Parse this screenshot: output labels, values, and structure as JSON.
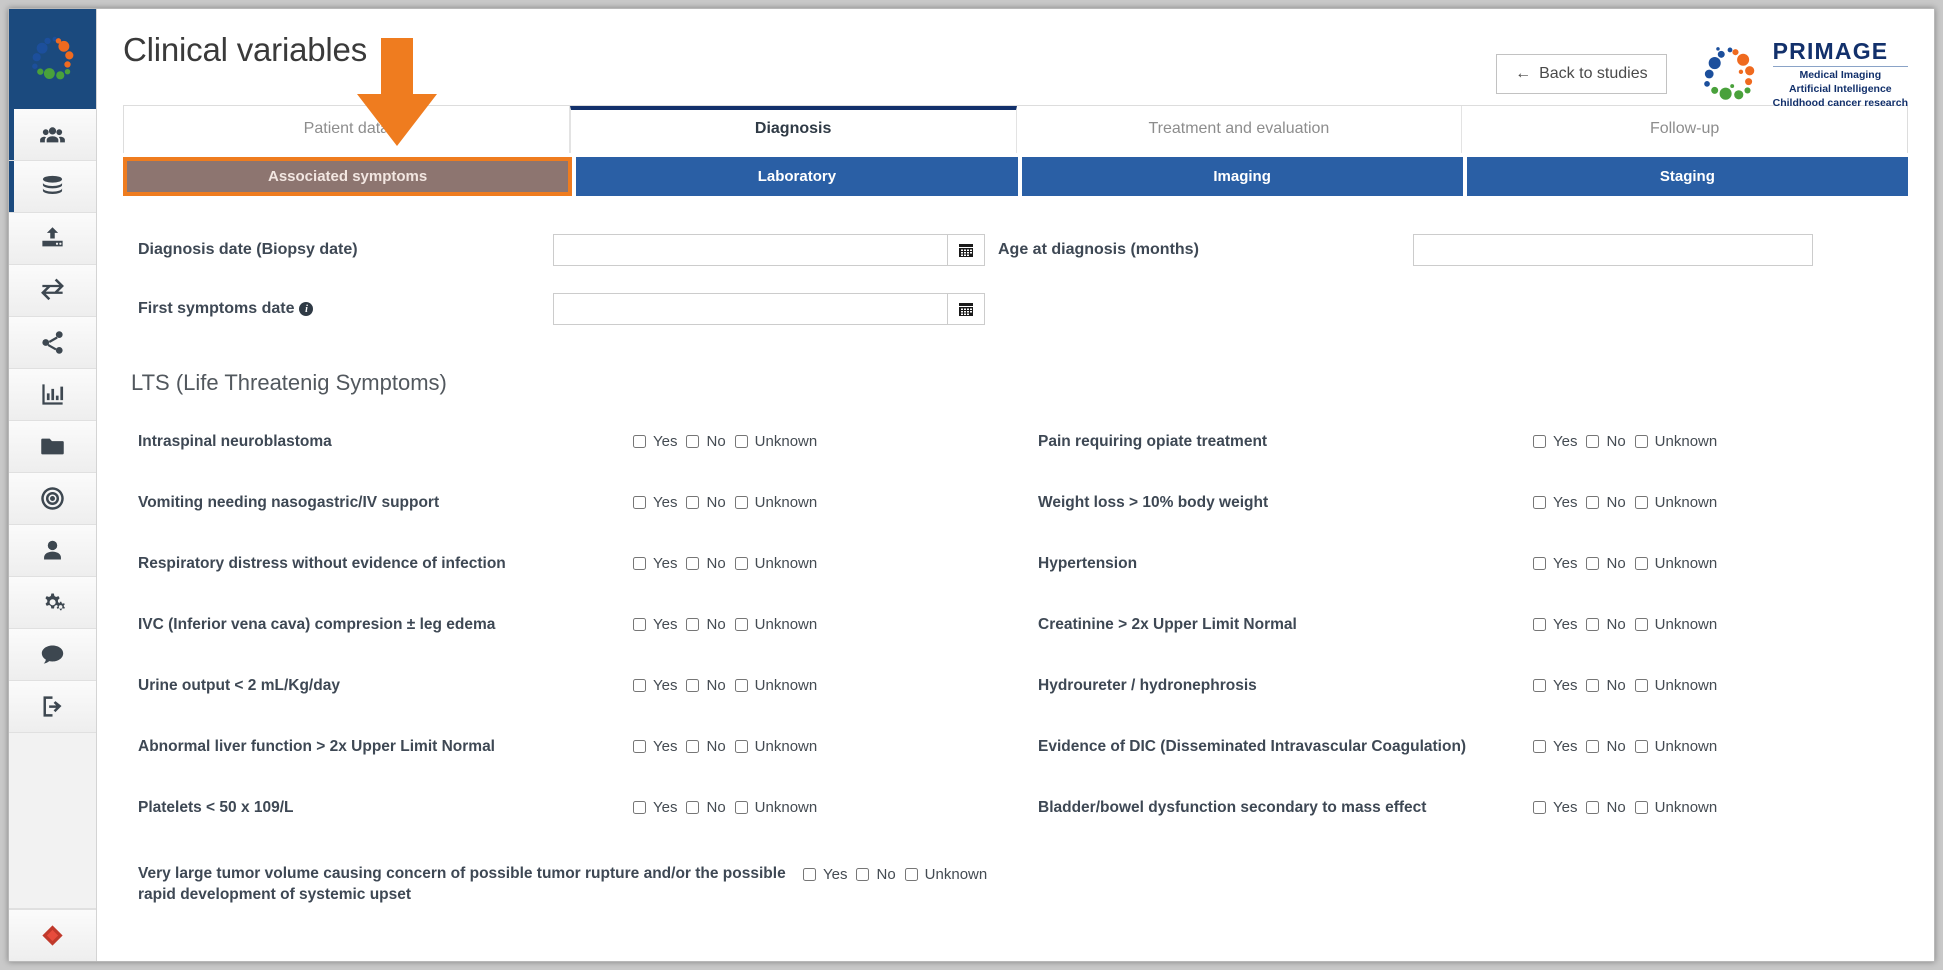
{
  "app": {
    "page_title": "Clinical variables",
    "back_button": "Back to studies",
    "back_arrow_icon": "arrow-left-icon",
    "brand": {
      "name": "PRIMAGE",
      "tagline_line1": "Medical Imaging",
      "tagline_line2": "Artificial Intelligence",
      "tagline_line3": "Childhood cancer research"
    },
    "accent_orange": "#ef7c1f",
    "accent_blue": "#2a5fa5",
    "brand_navy": "#12306b"
  },
  "sidebar": {
    "logo_icon": "primage-sphere-logo-icon",
    "items": [
      {
        "icon": "users-group-icon",
        "name": "patients",
        "active": true
      },
      {
        "icon": "database-icon",
        "name": "database",
        "active": true
      },
      {
        "icon": "upload-server-icon",
        "name": "upload",
        "active": false
      },
      {
        "icon": "exchange-arrows-icon",
        "name": "transfer",
        "active": false
      },
      {
        "icon": "share-nodes-icon",
        "name": "share",
        "active": false
      },
      {
        "icon": "bar-chart-icon",
        "name": "statistics",
        "active": false
      },
      {
        "icon": "folder-icon",
        "name": "files",
        "active": false
      },
      {
        "icon": "bullseye-target-icon",
        "name": "targets",
        "active": false
      },
      {
        "icon": "user-icon",
        "name": "profile",
        "active": false
      },
      {
        "icon": "gears-icon",
        "name": "settings",
        "active": false
      },
      {
        "icon": "comment-bubble-icon",
        "name": "messages",
        "active": false
      },
      {
        "icon": "logout-icon",
        "name": "logout",
        "active": false
      }
    ],
    "bottom_icon": "diamond-red-icon"
  },
  "tabs": [
    {
      "label": "Patient data",
      "active": false
    },
    {
      "label": "Diagnosis",
      "active": true
    },
    {
      "label": "Treatment and evaluation",
      "active": false
    },
    {
      "label": "Follow-up",
      "active": false
    }
  ],
  "subtabs": [
    {
      "label": "Associated symptoms",
      "selected": true
    },
    {
      "label": "Laboratory",
      "selected": false
    },
    {
      "label": "Imaging",
      "selected": false
    },
    {
      "label": "Staging",
      "selected": false
    }
  ],
  "fields": {
    "diagnosis_date_label": "Diagnosis date (Biopsy date)",
    "diagnosis_date_value": "",
    "first_symptoms_date_label": "First symptoms date",
    "first_symptoms_date_value": "",
    "first_symptoms_info_icon": "info-circle-icon",
    "age_at_diagnosis_label": "Age at diagnosis (months)",
    "age_at_diagnosis_value": "",
    "calendar_icon": "calendar-icon"
  },
  "section": {
    "lts_title": "LTS (Life Threatenig Symptoms)"
  },
  "choices": {
    "yes": "Yes",
    "no": "No",
    "unknown": "Unknown"
  },
  "symptoms_left": [
    "Intraspinal neuroblastoma",
    "Vomiting needing nasogastric/IV support",
    "Respiratory distress without evidence of infection",
    "IVC (Inferior vena cava) compresion ± leg edema",
    "Urine output < 2 mL/Kg/day",
    "Abnormal liver function > 2x Upper Limit Normal",
    "Platelets < 50 x 109/L"
  ],
  "symptoms_right": [
    "Pain requiring opiate treatment",
    "Weight loss > 10% body weight",
    "Hypertension",
    "Creatinine > 2x Upper Limit Normal",
    "Hydroureter / hydronephrosis",
    "Evidence of DIC (Disseminated Intravascular Coagulation)",
    "Bladder/bowel dysfunction secondary to mass effect"
  ],
  "symptom_wide": "Very large tumor volume causing concern of possible tumor rupture and/or the possible rapid development of systemic upset"
}
